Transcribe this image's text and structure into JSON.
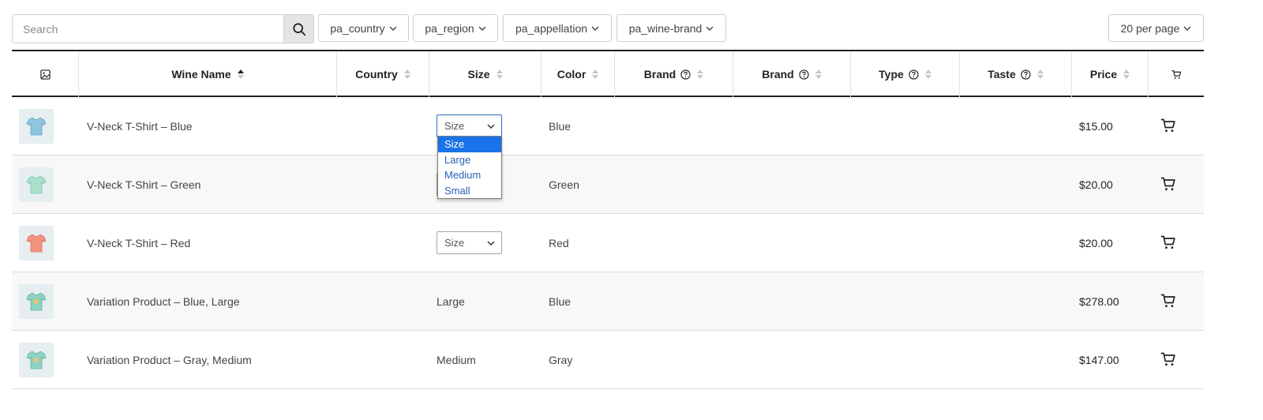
{
  "search": {
    "placeholder": "Search"
  },
  "filters": [
    {
      "label": "pa_country"
    },
    {
      "label": "pa_region"
    },
    {
      "label": "pa_appellation"
    },
    {
      "label": "pa_wine-brand"
    }
  ],
  "per_page": {
    "label": "20 per page"
  },
  "columns": {
    "image": "",
    "wine_name": "Wine Name",
    "country": "Country",
    "size": "Size",
    "color": "Color",
    "brand1": "Brand",
    "brand2": "Brand",
    "type": "Type",
    "taste": "Taste",
    "price": "Price"
  },
  "icons": {
    "search": "search-icon",
    "image": "image-icon",
    "cart": "cart-icon",
    "help": "help-icon",
    "chevron": "chevron-down-icon"
  },
  "rows": [
    {
      "name": "V-Neck T-Shirt – Blue",
      "size_select": "Size",
      "color": "Blue",
      "price": "$15.00",
      "shirt_color": "#8fc5df"
    },
    {
      "name": "V-Neck T-Shirt – Green",
      "color": "Green",
      "price": "$20.00",
      "shirt_color": "#a9e0cc"
    },
    {
      "name": "V-Neck T-Shirt – Red",
      "size_select": "Size",
      "color": "Red",
      "price": "$20.00",
      "shirt_color": "#f4937e"
    },
    {
      "name": "Variation Product – Blue, Large",
      "size": "Large",
      "color": "Blue",
      "price": "$278.00",
      "shirt_color": "#8dd2c0"
    },
    {
      "name": "Variation Product – Gray, Medium",
      "size": "Medium",
      "color": "Gray",
      "price": "$147.00",
      "shirt_color": "#8dd2c0"
    }
  ],
  "size_dropdown": {
    "options": [
      "Size",
      "Large",
      "Medium",
      "Small"
    ],
    "selected": "Size"
  },
  "colors": {
    "accent": "#1a73e8",
    "header_rule": "#1f1f1f",
    "row_alt": "#f8f8f8"
  }
}
